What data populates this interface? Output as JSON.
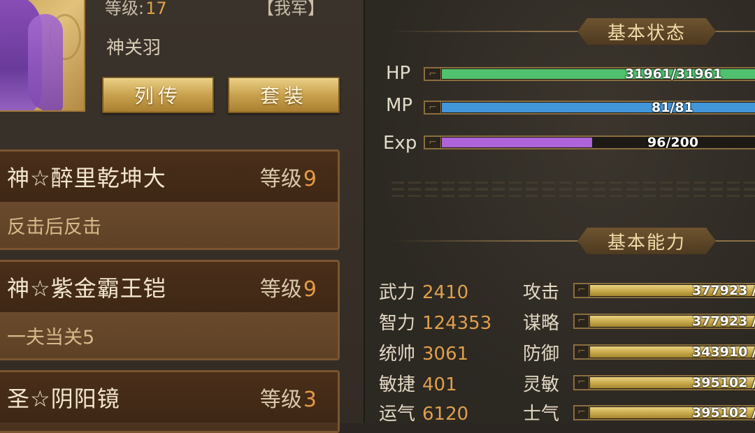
{
  "hero": {
    "level_label": "等级:",
    "level_value": "17",
    "faction": "【我军】",
    "name": "神关羽"
  },
  "buttons": {
    "biography": "列传",
    "suit": "套装"
  },
  "equipment": [
    {
      "name": "神☆醉里乾坤大",
      "level_label": "等级",
      "level": "9",
      "effect": "反击后反击"
    },
    {
      "name": "神☆紫金霸王铠",
      "level_label": "等级",
      "level": "9",
      "effect": "一夫当关5"
    },
    {
      "name": "圣☆阴阳镜",
      "level_label": "等级",
      "level": "3",
      "effect": ""
    }
  ],
  "basic_status": {
    "title": "基本状态",
    "hp": {
      "label": "HP",
      "text": "31961/31961",
      "current": 31961,
      "max": 31961,
      "color": "#4cb869"
    },
    "mp": {
      "label": "MP",
      "text": "81/81",
      "current": 81,
      "max": 81,
      "color": "#3f8fd0"
    },
    "exp": {
      "label": "Exp",
      "text": "96/200",
      "current": 96,
      "max": 200,
      "color": "#a55fcf"
    }
  },
  "basic_ability": {
    "title": "基本能力",
    "attributes": [
      {
        "name": "武力",
        "value": "2410"
      },
      {
        "name": "智力",
        "value": "124353"
      },
      {
        "name": "统帅",
        "value": "3061"
      },
      {
        "name": "敏捷",
        "value": "401"
      },
      {
        "name": "运气",
        "value": "6120"
      }
    ],
    "combat": [
      {
        "name": "攻击",
        "text": "377923 / "
      },
      {
        "name": "谋略",
        "text": "377923 / "
      },
      {
        "name": "防御",
        "text": "343910 / "
      },
      {
        "name": "灵敏",
        "text": "395102 / "
      },
      {
        "name": "士气",
        "text": "395102 / "
      }
    ]
  },
  "colors": {
    "accent_gold": "#c9a24e",
    "value_orange": "#e09f4c"
  }
}
